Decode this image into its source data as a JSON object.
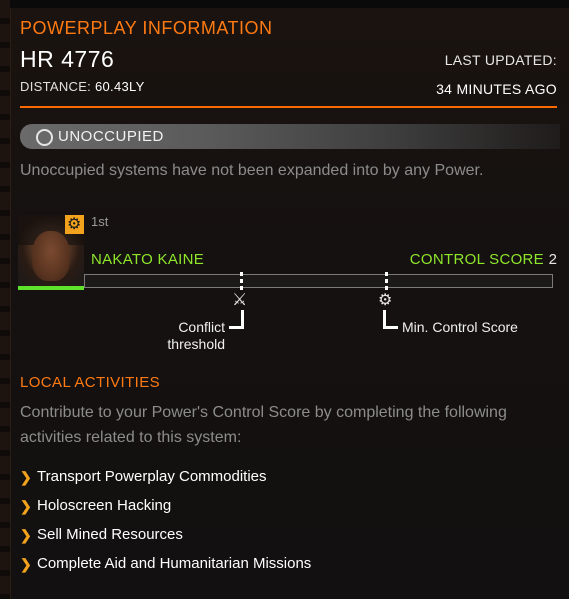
{
  "header": {
    "title": "POWERPLAY INFORMATION",
    "system_name": "HR 4776",
    "distance_label": "DISTANCE:",
    "distance_value": "60.43LY",
    "last_updated_label": "LAST UPDATED:",
    "last_updated_value": "34 MINUTES AGO"
  },
  "status": {
    "label": "UNOCCUPIED",
    "icon": "empty-circle-icon",
    "description": "Unoccupied systems have not been expanded into by any Power."
  },
  "power": {
    "rank": "1st",
    "name": "NAKATO KAINE",
    "badge_icon": "gear-badge-icon",
    "control_score_label": "CONTROL SCORE",
    "control_score_value": "2",
    "control_score_fill": 0.0
  },
  "thresholds": {
    "conflict_label": "Conflict threshold",
    "min_label": "Min. Control Score"
  },
  "local_activities": {
    "title": "LOCAL ACTIVITIES",
    "description": "Contribute to your Power's Control Score by completing the following activities related to this system:",
    "items": [
      {
        "label": "Transport Powerplay Commodities"
      },
      {
        "label": "Holoscreen Hacking"
      },
      {
        "label": "Sell Mined Resources"
      },
      {
        "label": "Complete Aid and Humanitarian Missions"
      }
    ]
  },
  "colors": {
    "accent_orange": "#ff7a12",
    "power_green": "#8ee62b",
    "bullet_gold": "#f2a21c"
  }
}
